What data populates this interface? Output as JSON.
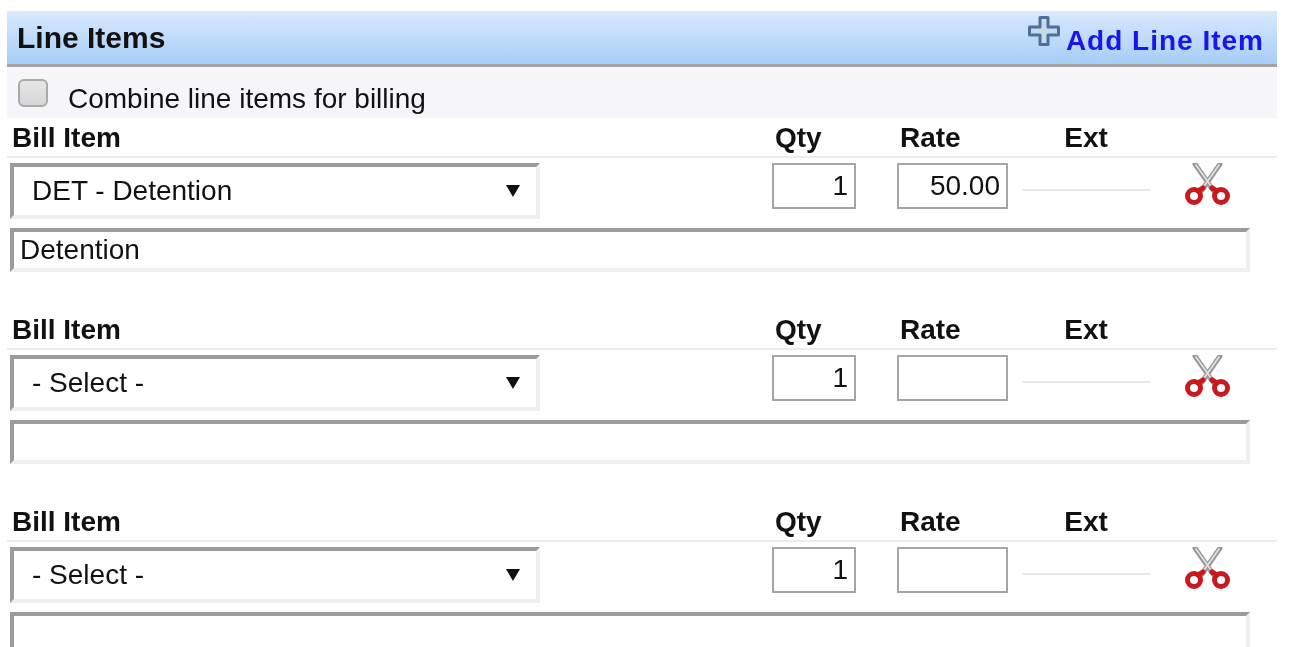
{
  "panel": {
    "title": "Line Items",
    "add_link": "Add Line Item"
  },
  "combine": {
    "label": "Combine line items for billing",
    "checked": false
  },
  "line_items": [
    {
      "labels": {
        "bill_item": "Bill Item",
        "qty": "Qty",
        "rate": "Rate",
        "ext": "Ext"
      },
      "bill_item": "DET - Detention",
      "qty": "1",
      "rate": "50.00",
      "description": "Detention"
    },
    {
      "labels": {
        "bill_item": "Bill Item",
        "qty": "Qty",
        "rate": "Rate",
        "ext": "Ext"
      },
      "bill_item": "- Select -",
      "qty": "1"
    },
    {
      "labels": {
        "bill_item": "Bill Item",
        "qty": "Qty",
        "rate": "Rate",
        "ext": "Ext"
      },
      "bill_item": "- Select -",
      "qty": "1"
    }
  ]
}
